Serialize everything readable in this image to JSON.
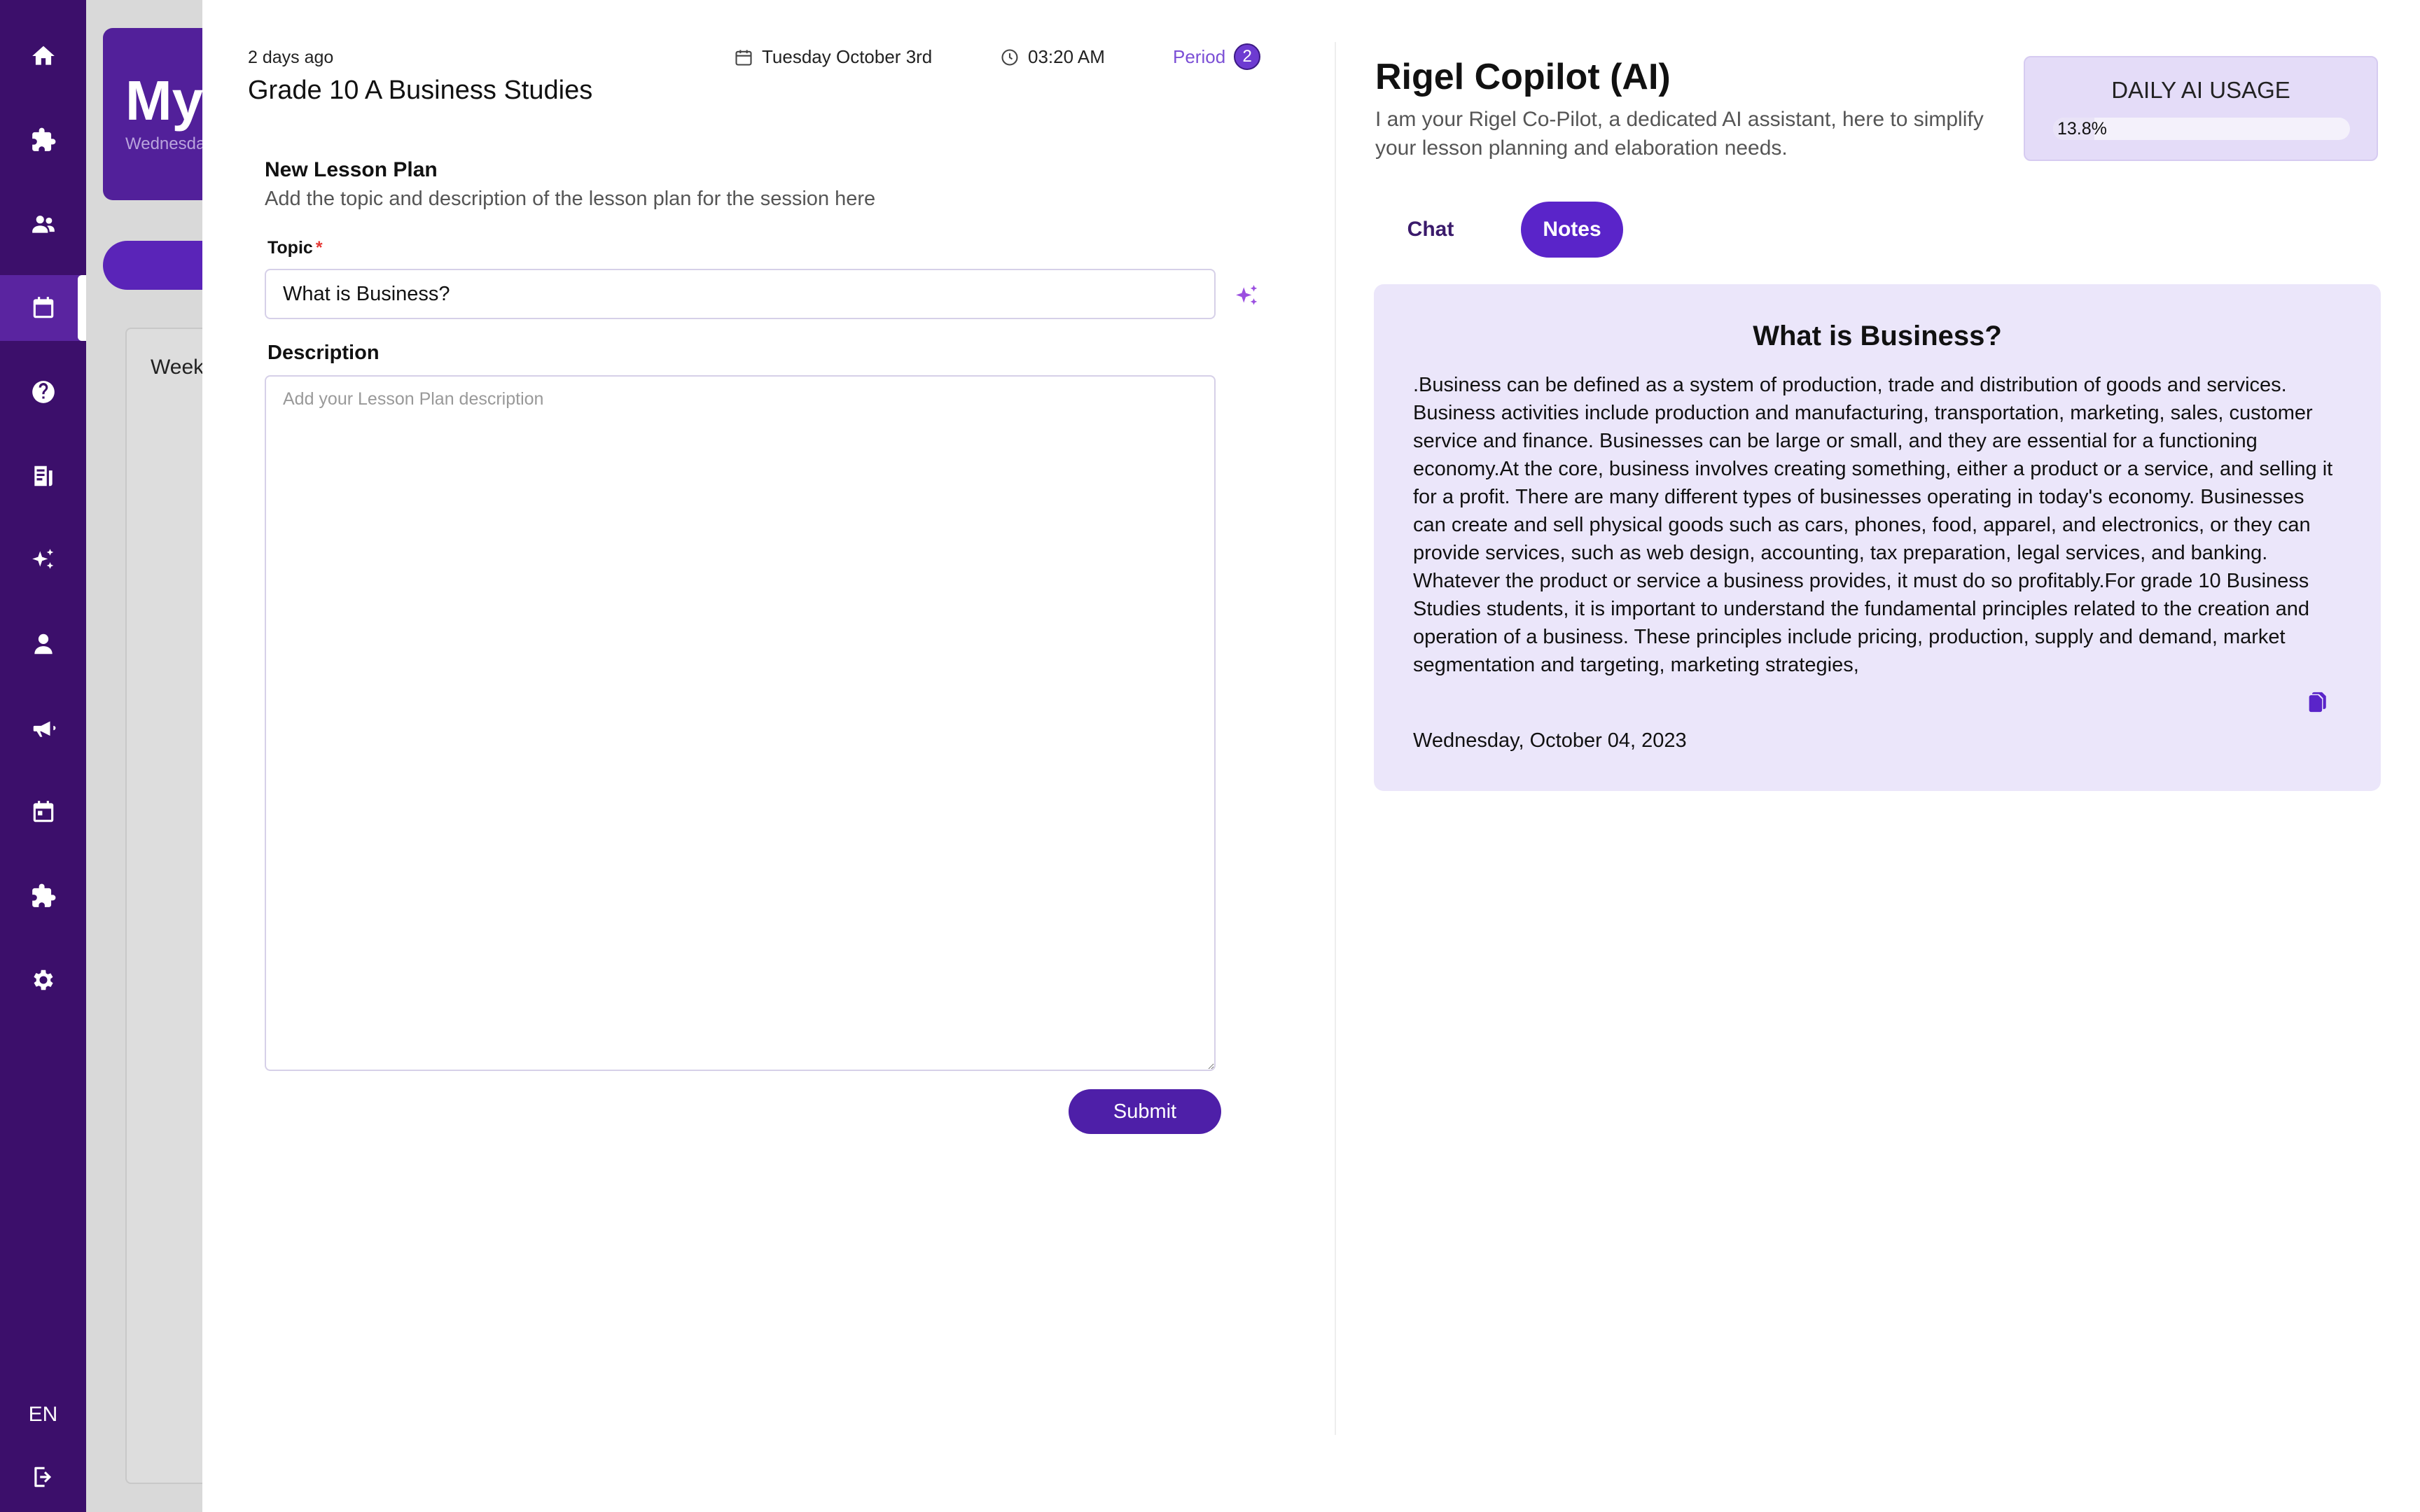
{
  "sidebar": {
    "items": [
      {
        "icon": "home-icon"
      },
      {
        "icon": "puzzle-icon"
      },
      {
        "icon": "users-icon"
      },
      {
        "icon": "calendar-icon",
        "active": true
      },
      {
        "icon": "help-icon"
      },
      {
        "icon": "report-icon"
      },
      {
        "icon": "sparkle-icon"
      },
      {
        "icon": "person-icon"
      },
      {
        "icon": "megaphone-icon"
      },
      {
        "icon": "schedule-icon"
      },
      {
        "icon": "puzzle-icon"
      },
      {
        "icon": "gear-icon"
      }
    ],
    "language": "EN",
    "logout_icon": "logout-icon"
  },
  "background": {
    "hero_title": "My",
    "hero_subtitle": "Wednesda",
    "card_label": "Week"
  },
  "lesson": {
    "time_ago": "2 days ago",
    "class_title": "Grade 10 A Business Studies",
    "date": "Tuesday October 3rd",
    "time": "03:20 AM",
    "period_label": "Period",
    "period_number": "2"
  },
  "form": {
    "title": "New Lesson Plan",
    "subtitle": "Add the topic and description of the lesson plan for the session here",
    "topic_label": "Topic",
    "topic_required": "*",
    "topic_value": "What is Business?",
    "description_label": "Description",
    "description_placeholder": "Add your Lesson Plan description",
    "submit_label": "Submit"
  },
  "copilot": {
    "title": "Rigel Copilot (AI)",
    "description": "I am your Rigel Co-Pilot, a dedicated AI assistant, here to simplify your lesson planning and elaboration needs.",
    "usage_title": "DAILY AI USAGE",
    "usage_percent_label": "13.8%",
    "usage_fraction": 0.138,
    "tabs": [
      {
        "label": "Chat",
        "active": false
      },
      {
        "label": "Notes",
        "active": true
      }
    ],
    "note": {
      "title": "What is Business?",
      "body": ".Business can be defined as a system of production, trade and distribution of goods and services. Business activities include production and manufacturing, transportation, marketing, sales, customer service and finance. Businesses can be large or small, and they are essential for a functioning economy.At the core, business involves creating something, either a product or a service, and selling it for a profit. There are many different types of businesses operating in today's economy. Businesses can create and sell physical goods such as cars, phones, food, apparel, and electronics, or they can provide services, such as web design, accounting, tax preparation, legal services, and banking. Whatever the product or service a business provides, it must do so profitably.For grade 10 Business Studies students, it is important to understand the fundamental principles related to the creation and operation of a business. These principles include pricing, production, supply and demand, market segmentation and targeting, marketing strategies,",
      "date": "Wednesday, October 04, 2023"
    }
  },
  "colors": {
    "sidebar": "#3c0f6b",
    "accent": "#5a24c9",
    "submit": "#4e1fa8",
    "notes_bg": "#ebe6fa",
    "usage_bg": "#e4dcf8"
  }
}
